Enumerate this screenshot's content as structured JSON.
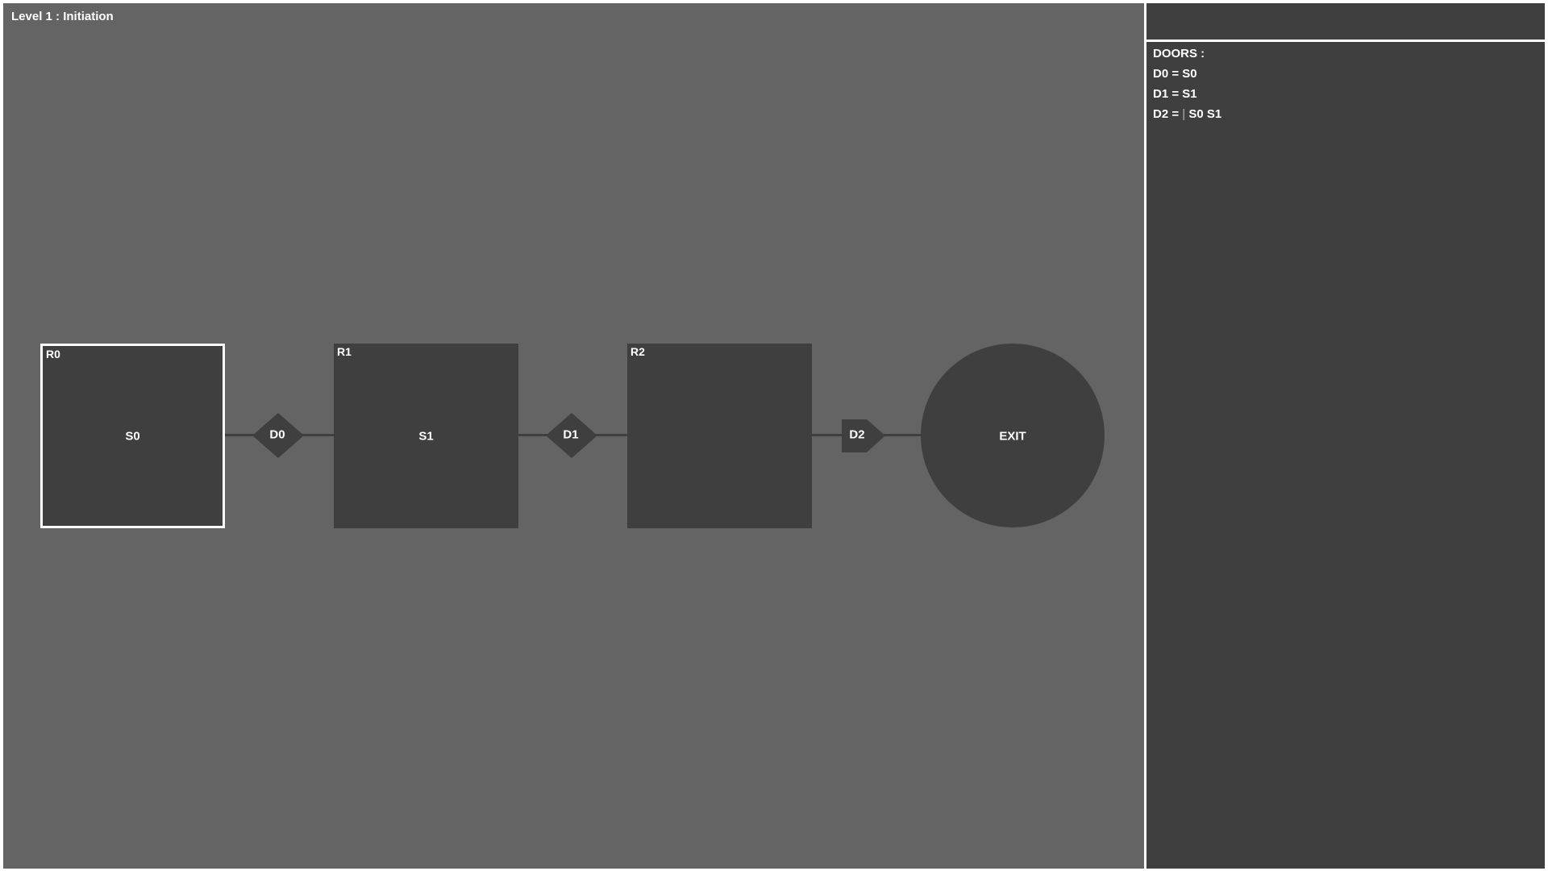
{
  "level_title": "Level 1 : Initiation",
  "rooms": [
    {
      "label": "R0",
      "content": "S0",
      "selected": true
    },
    {
      "label": "R1",
      "content": "S1",
      "selected": false
    },
    {
      "label": "R2",
      "content": "",
      "selected": false
    }
  ],
  "doors": [
    {
      "label": "D0",
      "shape": "diamond"
    },
    {
      "label": "D1",
      "shape": "diamond"
    },
    {
      "label": "D2",
      "shape": "pentagon-arrow"
    }
  ],
  "exit_label": "EXIT",
  "sidebar": {
    "heading": "DOORS :",
    "lines": [
      {
        "lhs": "D0 =",
        "pipe": "",
        "rhs": "S0"
      },
      {
        "lhs": "D1 =",
        "pipe": "",
        "rhs": "S1"
      },
      {
        "lhs": "D2 =",
        "pipe": "|",
        "rhs": "S0 S1"
      }
    ]
  },
  "colors": {
    "board": "#646464",
    "node": "#3f3f3f",
    "panel": "#3f3f3f",
    "selected_border": "#ffffff"
  }
}
